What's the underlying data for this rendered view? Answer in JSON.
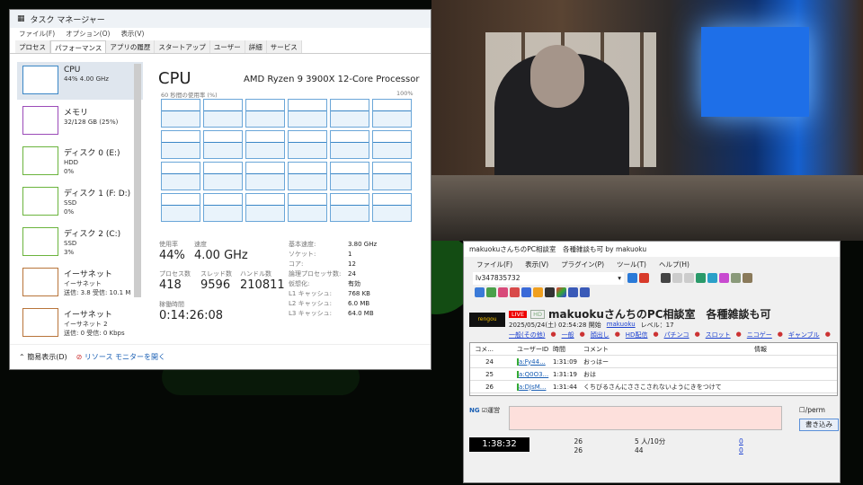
{
  "task_manager": {
    "title": "タスク マネージャー",
    "menu": [
      "ファイル(F)",
      "オプション(O)",
      "表示(V)"
    ],
    "tabs": [
      "プロセス",
      "パフォーマンス",
      "アプリの履歴",
      "スタートアップ",
      "ユーザー",
      "詳細",
      "サービス"
    ],
    "active_tab": "パフォーマンス",
    "sidebar": [
      {
        "name": "CPU",
        "l1": "44% 4.00 GHz",
        "l2": "",
        "l3": "",
        "color": "#3a86c6"
      },
      {
        "name": "メモリ",
        "l1": "32/128 GB (25%)",
        "l2": "",
        "l3": "",
        "color": "#9b4ab8"
      },
      {
        "name": "ディスク 0 (E:)",
        "l1": "HDD",
        "l2": "0%",
        "l3": "",
        "color": "#6bb43d"
      },
      {
        "name": "ディスク 1 (F: D:)",
        "l1": "SSD",
        "l2": "0%",
        "l3": "",
        "color": "#6bb43d"
      },
      {
        "name": "ディスク 2 (C:)",
        "l1": "SSD",
        "l2": "3%",
        "l3": "",
        "color": "#6bb43d"
      },
      {
        "name": "イーサネット",
        "l1": "イーサネット",
        "l2": "送信: 3.8 受信: 10.1 M",
        "l3": "",
        "color": "#b8743a"
      },
      {
        "name": "イーサネット",
        "l1": "イーサネット 2",
        "l2": "送信: 0 受信: 0 Kbps",
        "l3": "",
        "color": "#b8743a"
      }
    ],
    "cpu": {
      "heading": "CPU",
      "processor": "AMD Ryzen 9 3900X 12-Core Processor",
      "graph_label": "60 秒間の使用率 (%)",
      "graph_max": "100%",
      "usage_label": "使用率",
      "usage": "44%",
      "speed_label": "速度",
      "speed": "4.00 GHz",
      "proc_label": "プロセス数",
      "procs": "418",
      "thread_label": "スレッド数",
      "threads": "9596",
      "handle_label": "ハンドル数",
      "handles": "210811",
      "uptime_label": "稼働時間",
      "uptime": "0:14:26:08",
      "specs": [
        [
          "基本速度:",
          "3.80 GHz"
        ],
        [
          "ソケット:",
          "1"
        ],
        [
          "コア:",
          "12"
        ],
        [
          "論理プロセッサ数:",
          "24"
        ],
        [
          "仮想化:",
          "有効"
        ],
        [
          "L1 キャッシュ:",
          "768 KB"
        ],
        [
          "L2 キャッシュ:",
          "6.0 MB"
        ],
        [
          "L3 キャッシュ:",
          "64.0 MB"
        ]
      ]
    },
    "footer": {
      "simple": "簡易表示(D)",
      "resmon": "リソース モニターを開く"
    }
  },
  "nicolive": {
    "title": "makuokuさんちのPC相談室　各種雑談も可 by makuoku",
    "menu": [
      "ファイル(F)",
      "表示(V)",
      "プラグイン(P)",
      "ツール(T)",
      "ヘルプ(H)"
    ],
    "live_id": "lv347835732",
    "live_badge": "LIVE",
    "hd_badge": "HD",
    "logo": "rengou",
    "stream_title": "makuokuさんちのPC相談室　各種雑談も可",
    "start": "2025/05/24(土) 02:54:28 開始",
    "owner": "makuoku",
    "level": "レベル：17",
    "tags": [
      "一般(その他)",
      "一般",
      "顔出し",
      "HD配信",
      "パチンコ",
      "スロット",
      "ニコゲー",
      "ギャンブル"
    ],
    "columns": [
      "コメ...",
      "",
      "ユーザーID",
      "時間",
      "コメント",
      "情報"
    ],
    "comments": [
      {
        "no": "24",
        "uid": "a:Fy44...",
        "time": "1:31:09",
        "text": "おっはー"
      },
      {
        "no": "25",
        "uid": "a:Q0O3...",
        "time": "1:31:19",
        "text": "おは"
      },
      {
        "no": "26",
        "uid": "a:DJsM...",
        "time": "1:31:44",
        "text": "くちびるさんにささこされないようにきをつけて"
      }
    ],
    "ng": "NG",
    "unei": "運営",
    "perm": "/perm",
    "post": "書き込み",
    "elapsed": "1:38:32",
    "stats": {
      "comments_a": "26",
      "comments_b": "26",
      "viewers_rate": "5 人/10分",
      "viewers": "44",
      "ads": "0",
      "gifts": "0"
    }
  }
}
